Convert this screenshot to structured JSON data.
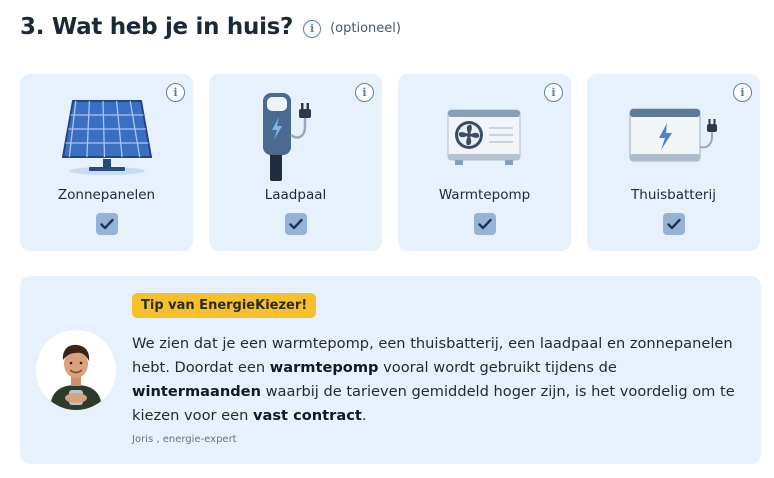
{
  "section": {
    "title": "3. Wat heb je in huis?",
    "optional_label": "(optioneel)",
    "info_icon": "info-icon"
  },
  "cards": [
    {
      "label": "Zonnepanelen",
      "icon": "solar-panel-icon",
      "checked": true
    },
    {
      "label": "Laadpaal",
      "icon": "charging-station-icon",
      "checked": true
    },
    {
      "label": "Warmtepomp",
      "icon": "heat-pump-icon",
      "checked": true
    },
    {
      "label": "Thuisbatterij",
      "icon": "home-battery-icon",
      "checked": true
    }
  ],
  "tip": {
    "badge": "Tip van EnergieKiezer!",
    "text_1": "We zien dat je een warmtepomp, een thuisbatterij, een laadpaal en zonnepanelen hebt. Doordat een ",
    "bold_1": "warmtepomp",
    "text_2": " vooral wordt gebruikt tijdens de ",
    "bold_2": "wintermaanden",
    "text_3": " waarbij de tarieven gemiddeld hoger zijn, is het voordelig om te kiezen voor een ",
    "bold_3": "vast contract",
    "text_4": ".",
    "author": "Joris , energie-expert"
  },
  "colors": {
    "card_bg": "#e6f1fb",
    "badge": "#f5c02c",
    "check": "#94b3d6",
    "heading": "#1b2838"
  }
}
